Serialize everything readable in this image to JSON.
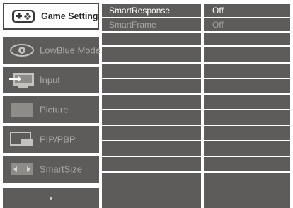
{
  "colors": {
    "panel": "#5e5c5a",
    "separator": "#ffffff",
    "selected_bg": "#ffffff",
    "text_active": "#ffffff",
    "text_dim": "#a9a7a4"
  },
  "menu": {
    "items": [
      {
        "label": "Game Setting",
        "icon": "gamepad-icon",
        "selected": true
      },
      {
        "label": "LowBlue Mode",
        "icon": "eye-icon",
        "selected": false
      },
      {
        "label": "Input",
        "icon": "input-icon",
        "selected": false
      },
      {
        "label": "Picture",
        "icon": "picture-icon",
        "selected": false
      },
      {
        "label": "PIP/PBP",
        "icon": "pip-icon",
        "selected": false
      },
      {
        "label": "SmartSize",
        "icon": "smartsize-icon",
        "selected": false
      }
    ],
    "more_arrow": "▼"
  },
  "submenu": {
    "items": [
      {
        "label": "SmartResponse"
      },
      {
        "label": "SmartFrame"
      }
    ]
  },
  "values": {
    "items": [
      {
        "label": "Off"
      },
      {
        "label": "Off"
      }
    ]
  }
}
